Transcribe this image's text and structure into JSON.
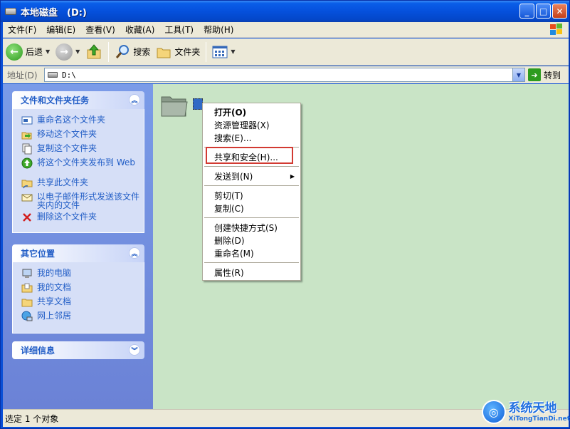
{
  "window": {
    "title": "本地磁盘　(D:)"
  },
  "menubar": {
    "items": [
      {
        "label": "文件(F)"
      },
      {
        "label": "编辑(E)"
      },
      {
        "label": "查看(V)"
      },
      {
        "label": "收藏(A)"
      },
      {
        "label": "工具(T)"
      },
      {
        "label": "帮助(H)"
      }
    ]
  },
  "toolbar": {
    "back_label": "后退",
    "search_label": "搜索",
    "folders_label": "文件夹"
  },
  "address": {
    "label": "地址(D)",
    "value": "D:\\",
    "go_label": "转到"
  },
  "left_panels": {
    "tasks": {
      "title": "文件和文件夹任务",
      "items": [
        {
          "label": "重命名这个文件夹"
        },
        {
          "label": "移动这个文件夹"
        },
        {
          "label": "复制这个文件夹"
        },
        {
          "label": "将这个文件夹发布到 Web"
        },
        {
          "label": "共享此文件夹"
        },
        {
          "label": "以电子邮件形式发送该文件夹内的文件"
        },
        {
          "label": "删除这个文件夹"
        }
      ]
    },
    "other_places": {
      "title": "其它位置",
      "items": [
        {
          "label": "我的电脑"
        },
        {
          "label": "我的文档"
        },
        {
          "label": "共享文档"
        },
        {
          "label": "网上邻居"
        }
      ]
    },
    "details": {
      "title": "详细信息"
    }
  },
  "context_menu": {
    "groups": [
      [
        {
          "label": "打开(O)",
          "bold": true
        },
        {
          "label": "资源管理器(X)"
        },
        {
          "label": "搜索(E)..."
        }
      ],
      [
        {
          "label": "共享和安全(H)..."
        }
      ],
      [
        {
          "label": "发送到(N)",
          "submenu": true
        }
      ],
      [
        {
          "label": "剪切(T)"
        },
        {
          "label": "复制(C)"
        }
      ],
      [
        {
          "label": "创建快捷方式(S)"
        },
        {
          "label": "删除(D)"
        },
        {
          "label": "重命名(M)"
        }
      ],
      [
        {
          "label": "属性(R)"
        }
      ]
    ],
    "highlight_color": "#d23a32"
  },
  "status": {
    "text": "选定 1 个对象"
  },
  "watermark": {
    "main": "系统天地",
    "sub": "XiTongTianDi.net"
  },
  "colors": {
    "title_bar": "#0550dc",
    "content_bg": "#c9e4c6",
    "task_link": "#215dc6"
  }
}
